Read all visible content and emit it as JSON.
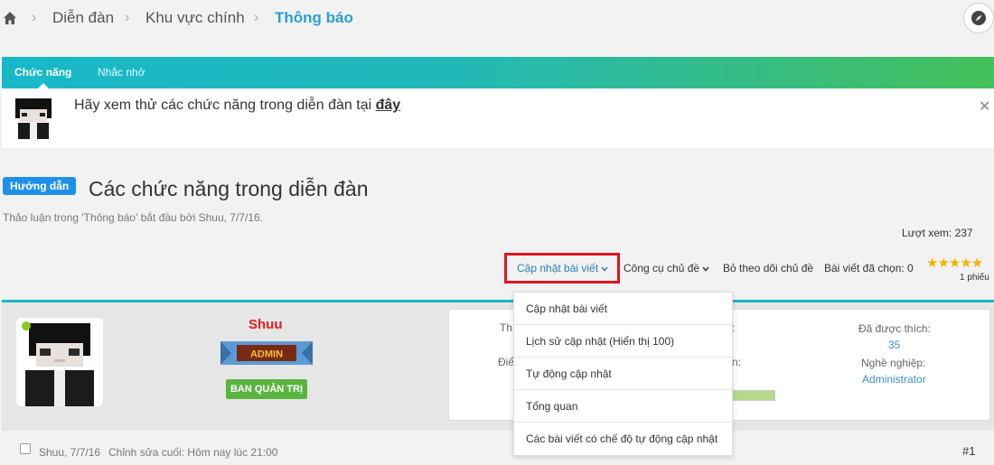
{
  "breadcrumb": {
    "items": [
      {
        "label": "Diễn đàn"
      },
      {
        "label": "Khu vực chính"
      },
      {
        "label": "Thông báo"
      }
    ]
  },
  "notice": {
    "tabs": [
      {
        "label": "Chức năng"
      },
      {
        "label": "Nhắc nhở"
      }
    ],
    "text_prefix": "Hãy xem thử các chức năng trong diễn đàn tại ",
    "link_label": "đây",
    "close_glyph": "✕"
  },
  "thread": {
    "prefix_label": "Hướng dẫn",
    "title": "Các chức năng trong diễn đàn",
    "meta": "Thảo luận trong 'Thông báo' bắt đầu bởi Shuu, 7/7/16.",
    "views": "Lượt xem: 237"
  },
  "tools": {
    "update_label": "Cập nhật bài viết",
    "thread_tools_label": "Công cụ chủ đề",
    "unwatch_label": "Bỏ theo dõi chủ đề",
    "selected_label": "Bài viết đã chọn: 0",
    "rating_stars": "★★★★★",
    "votes": "1 phiếu"
  },
  "dropdown": {
    "items": [
      {
        "label": "Cập nhật bài viết"
      },
      {
        "label": "Lịch sử cập nhật (Hiển thị 100)"
      },
      {
        "label": "Tự động cập nhật"
      },
      {
        "label": "Tổng quan"
      },
      {
        "label": "Các bài viết có chế độ tự động cập nhật"
      }
    ]
  },
  "post": {
    "username": "Shuu",
    "banner_text": "ADMIN",
    "role_badge": "BAN QUẢN TRỊ",
    "stats": {
      "left_label_1": "Th",
      "left_label_2": "Điể",
      "mid_suffix_1": ":",
      "mid_suffix_2": "n:",
      "likes_label": "Đã được thích:",
      "likes_value": "35",
      "job_label": "Nghề nghiệp:",
      "job_value": "Administrator"
    },
    "date": "Shuu, 7/7/16",
    "edited": "Chỉnh sửa cuối: Hôm nay lúc 21:00",
    "number": "#1"
  },
  "colors": {
    "accent": "#2a9fd6",
    "username": "#e02020",
    "role_badge": "#5ab540",
    "highlight_box": "#e0161c"
  },
  "icons": [
    "home-icon",
    "compass-icon",
    "close-icon",
    "chevron-down-icon",
    "star-icon"
  ]
}
